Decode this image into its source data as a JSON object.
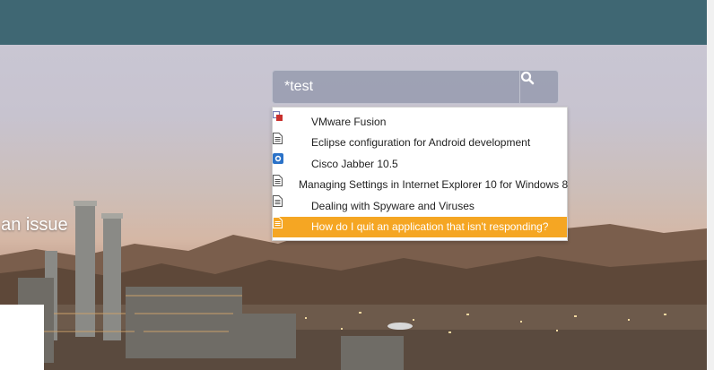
{
  "hero": {
    "headline": "t an issue"
  },
  "search": {
    "value": "*test",
    "button_icon": "search-icon"
  },
  "suggestions": [
    {
      "label": "VMware Fusion",
      "icon": "vmware-icon",
      "active": false
    },
    {
      "label": "Eclipse configuration for Android development",
      "icon": "document-icon",
      "active": false
    },
    {
      "label": "Cisco Jabber 10.5",
      "icon": "cisco-jabber-icon",
      "active": false
    },
    {
      "label": "Managing Settings in Internet Explorer 10 for Windows 8",
      "icon": "document-icon",
      "active": false
    },
    {
      "label": "Dealing with Spyware and Viruses",
      "icon": "document-icon",
      "active": false
    },
    {
      "label": "How do I quit an application that isn't responding?",
      "icon": "document-icon",
      "active": true
    }
  ],
  "colors": {
    "topbar": "#3f6773",
    "highlight": "#f5a623"
  }
}
